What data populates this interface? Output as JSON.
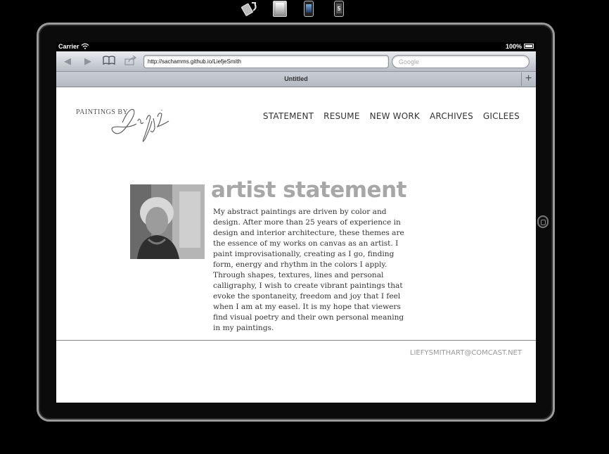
{
  "simulator": {
    "buttons": [
      {
        "name": "rotate-icon"
      },
      {
        "name": "ipad-device-icon"
      },
      {
        "name": "iphone-device-icon"
      },
      {
        "name": "iphone5-device-icon",
        "label": "5"
      }
    ]
  },
  "status_bar": {
    "carrier": "Carrier",
    "battery": "100%"
  },
  "browser": {
    "url": "http://sachamms.github.io/LiefjeSmith",
    "search_placeholder": "Google",
    "tab_title": "Untitled",
    "new_tab": "+"
  },
  "site": {
    "logo_prefix": "PAINTINGS BY",
    "logo_script": "Liefje",
    "nav": [
      "STATEMENT",
      "RESUME",
      "NEW WORK",
      "ARCHIVES",
      "GICLEES"
    ],
    "heading": "artist statement",
    "body": "My abstract paintings are driven by color and design. After more than 25 years of experience in design and interior architecture, these themes are the essence of my works on canvas as an artist. I paint improvisationally, creating as I go, finding form, energy and rhythm in the colors I apply. Through shapes, textures, lines and personal calligraphy, I wish to create vibrant paintings that evoke the spontaneity, freedom and joy that I feel when I am at my easel. It is my hope that viewers find visual poetry and their own personal meaning in my paintings.",
    "footer_email": "LIEFYSMITHART@COMCAST.NET"
  },
  "colors": {
    "heading": "#a7a7a7",
    "body_text": "#333333",
    "footer_text": "#999999"
  }
}
